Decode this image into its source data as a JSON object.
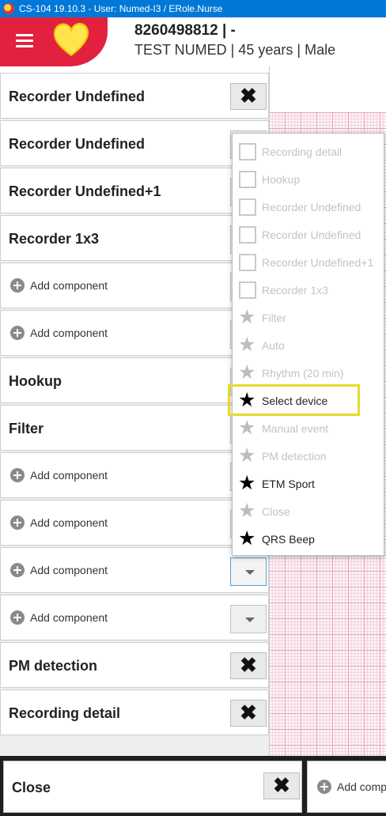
{
  "titlebar": {
    "text": "CS-104 19.10.3 - User: Numed-I3 / ERole.Nurse"
  },
  "patient": {
    "id": "8260498812 | -",
    "info": "TEST NUMED | 45 years | Male"
  },
  "panel": {
    "rows": [
      {
        "type": "item",
        "label": "Recorder Undefined",
        "control": "close"
      },
      {
        "type": "item",
        "label": "Recorder Undefined",
        "control": "dropdown"
      },
      {
        "type": "item",
        "label": "Recorder Undefined+1",
        "control": "dropdown"
      },
      {
        "type": "item",
        "label": "Recorder 1x3",
        "control": "dropdown"
      },
      {
        "type": "add",
        "label": "Add component",
        "control": "dropdown"
      },
      {
        "type": "add",
        "label": "Add component",
        "control": "dropdown"
      },
      {
        "type": "item",
        "label": "Hookup",
        "control": "dropdown"
      },
      {
        "type": "item",
        "label": "Filter",
        "control": "dropdown"
      },
      {
        "type": "add",
        "label": "Add component",
        "control": "dropdown"
      },
      {
        "type": "add",
        "label": "Add component",
        "control": "dropdown"
      },
      {
        "type": "add",
        "label": "Add component",
        "control": "dropdown",
        "active": true
      },
      {
        "type": "add",
        "label": "Add component",
        "control": "dropdown"
      },
      {
        "type": "item",
        "label": "PM detection",
        "control": "close"
      },
      {
        "type": "item",
        "label": "Recording detail",
        "control": "close"
      }
    ]
  },
  "dropdown": {
    "items": [
      {
        "label": "Recording detail",
        "icon": "checkbox-icon",
        "enabled": false
      },
      {
        "label": "Hookup",
        "icon": "checkbox-icon",
        "enabled": false
      },
      {
        "label": "Recorder Undefined",
        "icon": "checkbox-icon",
        "enabled": false
      },
      {
        "label": "Recorder Undefined",
        "icon": "checkbox-icon",
        "enabled": false
      },
      {
        "label": "Recorder Undefined+1",
        "icon": "checkbox-icon",
        "enabled": false
      },
      {
        "label": "Recorder 1x3",
        "icon": "checkbox-icon",
        "enabled": false
      },
      {
        "label": "Filter",
        "icon": "star-icon",
        "enabled": false
      },
      {
        "label": "Auto",
        "icon": "star-icon",
        "enabled": false
      },
      {
        "label": "Rhythm (20 min)",
        "icon": "star-icon",
        "enabled": false
      },
      {
        "label": "Select device",
        "icon": "star-icon",
        "enabled": true,
        "highlighted": true
      },
      {
        "label": "Manual event",
        "icon": "star-icon",
        "enabled": false
      },
      {
        "label": "PM detection",
        "icon": "star-icon",
        "enabled": false
      },
      {
        "label": "ETM Sport",
        "icon": "star-icon",
        "enabled": true
      },
      {
        "label": "Close",
        "icon": "star-icon",
        "enabled": false
      },
      {
        "label": "QRS Beep",
        "icon": "star-icon",
        "enabled": true
      }
    ]
  },
  "footer": {
    "close_label": "Close",
    "add_label": "Add comp"
  },
  "glyphs": {
    "close": "✖",
    "star": "★"
  },
  "colors": {
    "brand": "#e2213f",
    "titlebar": "#0078d7",
    "highlight": "#e8d92c",
    "ecg_grid": "#e7a3b7"
  }
}
